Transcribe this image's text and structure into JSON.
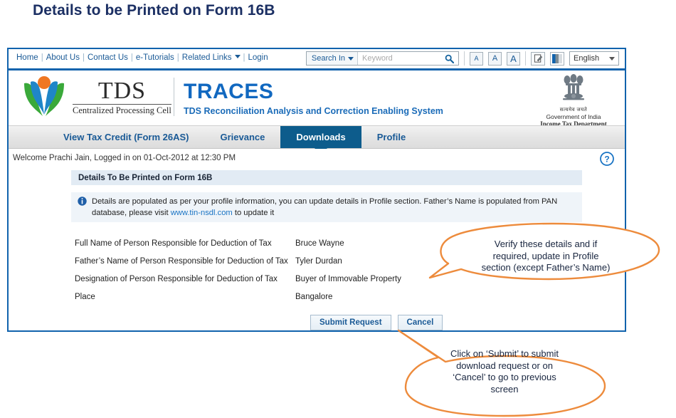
{
  "slide": {
    "title": "Details to be Printed on Form 16B"
  },
  "utility_bar": {
    "links": [
      {
        "label": "Home"
      },
      {
        "label": "About Us"
      },
      {
        "label": "Contact Us"
      },
      {
        "label": "e-Tutorials"
      },
      {
        "label": "Related Links",
        "has_caret": true
      },
      {
        "label": "Login"
      }
    ],
    "separator": "|",
    "search": {
      "scope_label": "Search In",
      "placeholder": "Keyword",
      "value": "",
      "icon": "search-icon"
    },
    "font_size_buttons": [
      "A",
      "A",
      "A"
    ],
    "accessibility_icon": "screen-reader-icon",
    "contrast_icon": "high-contrast-icon",
    "language": {
      "selected": "English"
    }
  },
  "brand": {
    "logo_icon": "tds-cpc-logo",
    "tds_word": "TDS",
    "tds_subtitle": "Centralized Processing Cell",
    "traces_title": "TRACES",
    "traces_subtitle": "TDS Reconciliation Analysis and Correction Enabling System",
    "emblem_icon": "india-national-emblem",
    "emblem_hindi": "सत्यमेव जयते",
    "emblem_line1": "Government of India",
    "emblem_line2": "Income Tax Department"
  },
  "nav": {
    "tabs": [
      {
        "label": "View Tax Credit (Form 26AS)",
        "active": false
      },
      {
        "label": "Grievance",
        "active": false
      },
      {
        "label": "Downloads",
        "active": true
      },
      {
        "label": "Profile",
        "active": false
      }
    ]
  },
  "session": {
    "welcome": "Welcome Prachi Jain, Logged in on 01-Oct-2012 at 12:30 PM",
    "help_icon": "help-question-icon"
  },
  "content": {
    "section_title": "Details To Be Printed on Form 16B",
    "info": {
      "icon": "info-icon",
      "text_before_link": "Details are populated as per your profile information, you can update details in Profile section. Father’s Name is populated from PAN database, please visit ",
      "link_text": "www.tin-nsdl.com",
      "text_after_link": " to update it"
    },
    "fields": [
      {
        "label": "Full Name of Person Responsible for Deduction of Tax",
        "value": "Bruce Wayne"
      },
      {
        "label": "Father’s Name of Person Responsible for Deduction of Tax",
        "value": "Tyler Durdan"
      },
      {
        "label": "Designation of Person Responsible for Deduction of Tax",
        "value": "Buyer of Immovable Property"
      },
      {
        "label": "Place",
        "value": "Bangalore"
      }
    ],
    "buttons": [
      {
        "label": "Submit Request",
        "name": "submit-request-button"
      },
      {
        "label": "Cancel",
        "name": "cancel-button"
      }
    ]
  },
  "annotations": {
    "accent_color": "#ED8B3C",
    "callouts": [
      {
        "name": "callout-verify-details",
        "lines": [
          "Verify these details and if",
          "required, update in Profile",
          "section (except Father’s Name)"
        ]
      },
      {
        "name": "callout-submit-cancel",
        "lines": [
          "Click on ‘Submit’ to submit",
          "download request or on",
          "‘Cancel’ to go to previous",
          "screen"
        ]
      }
    ]
  }
}
